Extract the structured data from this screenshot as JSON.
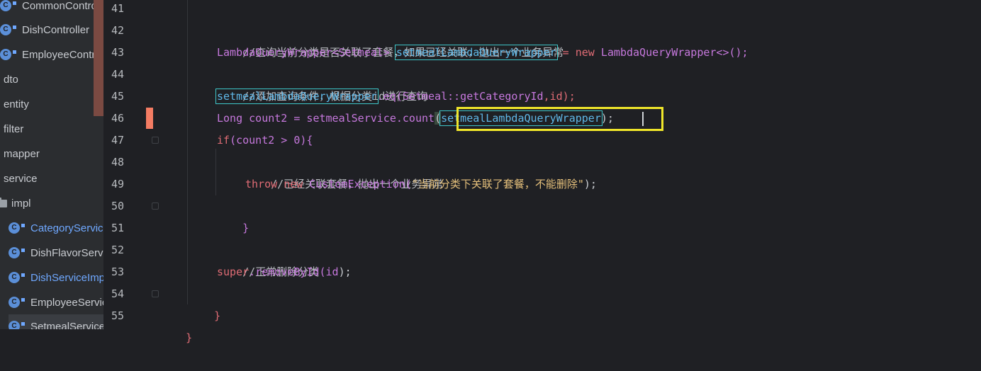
{
  "sidebar": {
    "items": [
      {
        "label": "CommonController",
        "kind": "class",
        "indent": 0
      },
      {
        "label": "DishController",
        "kind": "class",
        "indent": 0
      },
      {
        "label": "EmployeeController",
        "kind": "class",
        "indent": 0
      },
      {
        "label": "dto",
        "kind": "package",
        "indent": -1
      },
      {
        "label": "entity",
        "kind": "package",
        "indent": -1
      },
      {
        "label": "filter",
        "kind": "package",
        "indent": -1
      },
      {
        "label": "mapper",
        "kind": "package",
        "indent": -1
      },
      {
        "label": "service",
        "kind": "package",
        "indent": -1
      },
      {
        "label": "impl",
        "kind": "folder",
        "indent": 0
      },
      {
        "label": "CategoryServiceImpl",
        "kind": "class-link",
        "indent": 1
      },
      {
        "label": "DishFlavorServiceImpl",
        "kind": "class",
        "indent": 1
      },
      {
        "label": "DishServiceImpl",
        "kind": "class-link",
        "indent": 1
      },
      {
        "label": "EmployeeServiceImpl",
        "kind": "class",
        "indent": 1
      },
      {
        "label": "SetmealServiceImpl",
        "kind": "class",
        "indent": 1
      }
    ]
  },
  "editor": {
    "line_numbers": [
      "41",
      "42",
      "43",
      "44",
      "45",
      "46",
      "47",
      "48",
      "49",
      "50",
      "51",
      "52",
      "53",
      "54",
      "55"
    ],
    "lines": {
      "l42_comment": "//查询当前分类是否关联了套餐，如果已经关联，抛出一个业务异常",
      "l43_type": "LambdaQueryWrapper",
      "l43_generic": "<Setmeal>",
      "l43_var": "setmealLambdaQueryWrapper",
      "l43_eq": " = ",
      "l43_new": "new",
      "l43_ctor": " LambdaQueryWrapper<>();",
      "l44_comment": "//添加查询条件，根据分类id进行查询",
      "l45_var": "setmealLambdaQueryWrapper",
      "l45_method": ".eq(",
      "l45_ref": "Setmeal::getCategoryId",
      "l45_arg": ",id);",
      "l46_type": "Long",
      "l46_var": " count2 = setmealService.",
      "l46_method": "count",
      "l46_open": "(",
      "l46_arg": "setmealLambdaQueryWrapper",
      "l46_close": ");",
      "l47_if": "if",
      "l47_rest": "(count2 > 0){",
      "l48_comment": "//已经关联套餐，抛出一个业务异常",
      "l49_throw": "throw",
      "l49_new": "new",
      "l49_class": " CustomException(",
      "l49_str": "\"当前分类下关联了套餐，不能删除\"",
      "l49_end": ");",
      "l50_brace": "}",
      "l52_comment": "//正常删除分类",
      "l53_super": "super",
      "l53_method": ".removeById(",
      "l53_arg": "id",
      "l53_end": ");",
      "l54_brace": "}",
      "l55_brace": "}"
    }
  },
  "colors": {
    "background": "#1f2024",
    "keyword": "#e06c75",
    "type": "#c678dd",
    "highlight_box": "#f0e62a",
    "usage_outline": "#3ec6c9",
    "change_marker": "#f47c63"
  }
}
